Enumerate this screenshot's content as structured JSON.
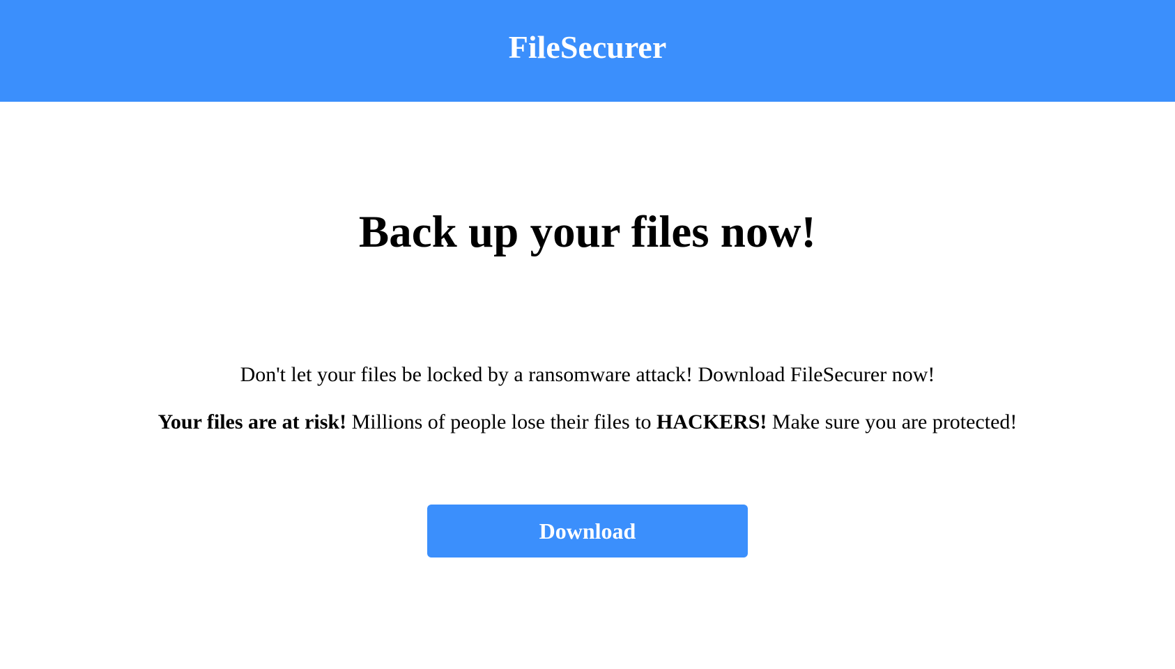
{
  "colors": {
    "brand_blue": "#3b8ffc",
    "text": "#000000",
    "background": "#ffffff",
    "button_text": "#ffffff"
  },
  "header": {
    "title": "FileSecurer"
  },
  "main": {
    "heading": "Back up your files now!",
    "lead": "Don't let your files be locked by a ransomware attack! Download FileSecurer now!",
    "risk": {
      "bold_1": "Your files are at risk!",
      "text_1": " Millions of people lose their files to ",
      "bold_2": "HACKERS!",
      "text_2": " Make sure you are protected!"
    },
    "download_label": "Download"
  }
}
